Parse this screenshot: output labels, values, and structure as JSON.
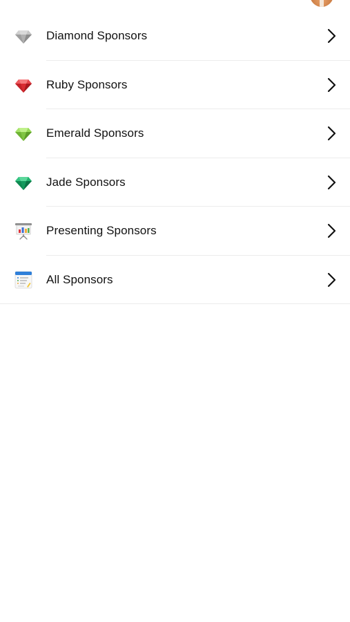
{
  "header": {
    "avatar_icon": "user-avatar"
  },
  "sponsors": {
    "items": [
      {
        "label": "Diamond Sponsors",
        "icon": "diamond-gem-icon",
        "color": "#a9a9a9"
      },
      {
        "label": "Ruby Sponsors",
        "icon": "ruby-gem-icon",
        "color": "#e0353b"
      },
      {
        "label": "Emerald Sponsors",
        "icon": "emerald-gem-icon",
        "color": "#8bd14a"
      },
      {
        "label": "Jade Sponsors",
        "icon": "jade-gem-icon",
        "color": "#17a866"
      },
      {
        "label": "Presenting Sponsors",
        "icon": "presentation-board-icon",
        "color": "#3b6fd6"
      },
      {
        "label": "All Sponsors",
        "icon": "list-document-icon",
        "color": "#2f7fd9"
      }
    ]
  }
}
